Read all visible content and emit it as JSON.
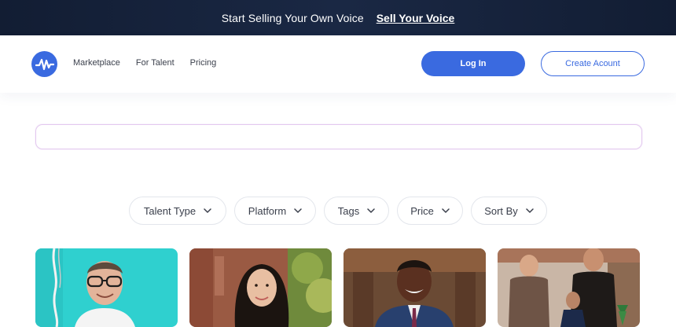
{
  "promo": {
    "text": "Start Selling Your Own Voice",
    "link": "Sell Your Voice"
  },
  "nav": {
    "links": [
      "Marketplace",
      "For Talent",
      "Pricing"
    ],
    "login": "Log In",
    "create_account": "Create Acount"
  },
  "search": {
    "placeholder": "",
    "value": ""
  },
  "filters": [
    "Talent Type",
    "Platform",
    "Tags",
    "Price",
    "Sort By"
  ],
  "colors": {
    "brand": "#3a6ae0",
    "promo_bg": "#152139"
  },
  "icons": {
    "logo": "waveform-logo-icon",
    "filter": "chevron-down-icon"
  }
}
